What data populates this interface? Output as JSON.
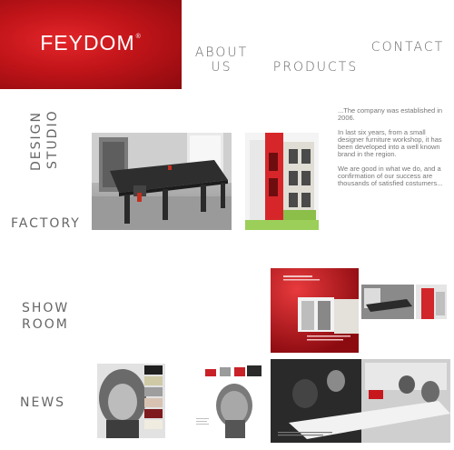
{
  "logo": {
    "text": "FEYDOM",
    "mark": "®"
  },
  "nav": {
    "about_line1": "ABOUT",
    "about_line2": "US",
    "products": "PRODUCTS",
    "contact": "CONTACT"
  },
  "sections": {
    "design": "DESIGN",
    "studio": "STUDIO",
    "factory": "FACTORY",
    "show": "SHOW",
    "room": "ROOM",
    "news": "NEWS"
  },
  "about": {
    "p1": "...The company was established in 2006.",
    "p2": "In last six years, from a small designer furniture workshop, it has been developed into a well known brand in the region.",
    "p3": "We are good in what we do, and a confirmation of our success are thousands of satisfied costumers..."
  },
  "colors": {
    "brand_red": "#c8161d",
    "nav_gray": "#666666"
  }
}
